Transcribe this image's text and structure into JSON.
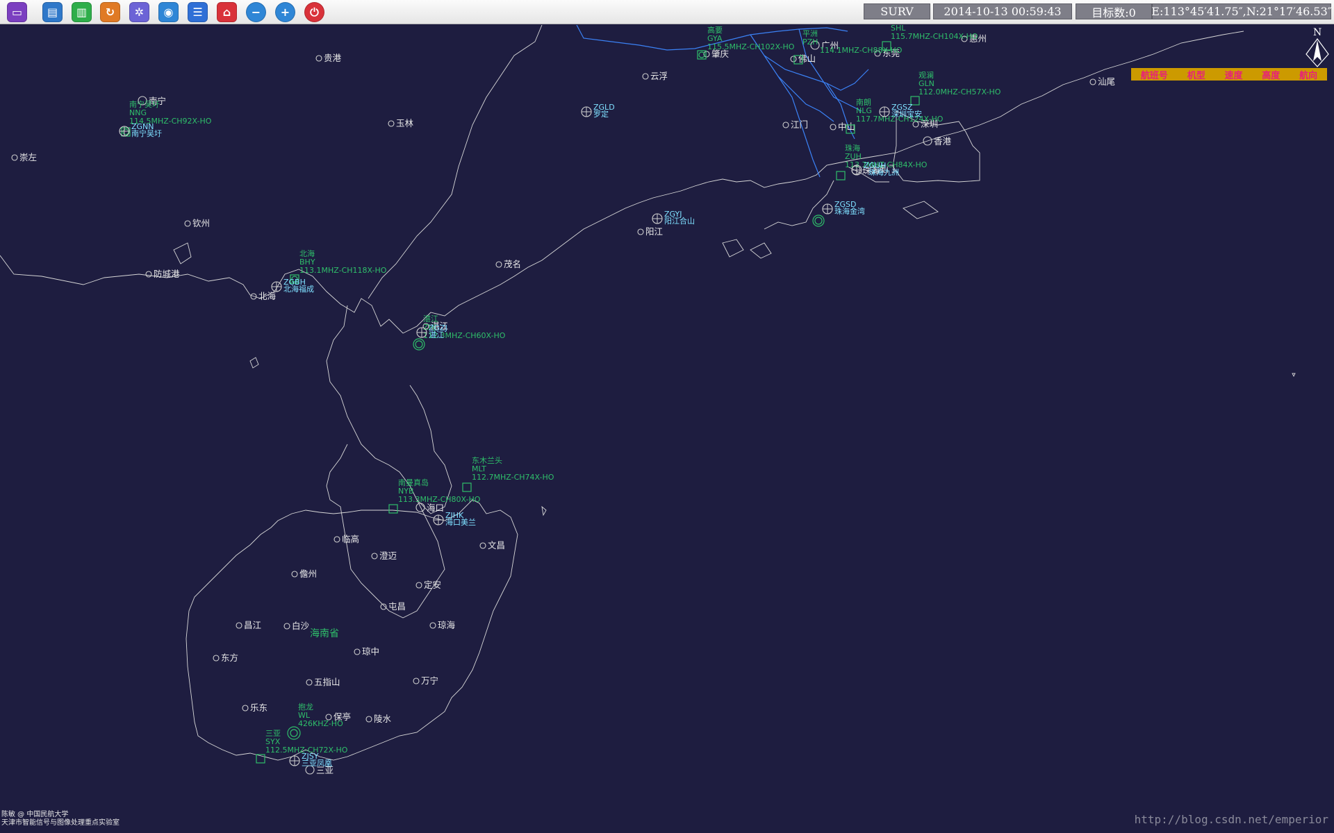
{
  "toolbar": {
    "buttons": [
      {
        "name": "monitor-icon",
        "color": "#7b3fc0"
      },
      {
        "name": "note-icon",
        "color": "#2f78c9"
      },
      {
        "name": "radar-icon",
        "color": "#2fae4a"
      },
      {
        "name": "refresh-icon",
        "color": "#e07a25"
      },
      {
        "name": "settings-icon",
        "color": "#6c63d6"
      },
      {
        "name": "globe-icon",
        "color": "#2f86d6"
      },
      {
        "name": "list-icon",
        "color": "#2f6fd6"
      },
      {
        "name": "home-icon",
        "color": "#d9323a"
      },
      {
        "name": "zoom-out-icon",
        "color": "#2f86d6"
      },
      {
        "name": "zoom-in-icon",
        "color": "#2f86d6"
      },
      {
        "name": "power-icon",
        "color": "#d9323a"
      }
    ],
    "mode": "SURV",
    "datetime": "2014-10-13 00:59:43",
    "target_count": "目标数:0",
    "coordinates": "E:113°45′41.75″,N:21°17′46.53″"
  },
  "legend": [
    "航班号",
    "机型",
    "速度",
    "高度",
    "航向"
  ],
  "north_label": "N",
  "province_label": "海南省",
  "cities": [
    "贵港",
    "南宁",
    "玉林",
    "崇左",
    "钦州",
    "防城港",
    "北海",
    "茂名",
    "云浮",
    "肇庆",
    "佛山",
    "广州",
    "东莞",
    "惠州",
    "江门",
    "中山",
    "深圳",
    "香港",
    "珠海",
    "澳门",
    "阳江",
    "湛江",
    "汕尾",
    "海口",
    "临高",
    "澄迈",
    "文昌",
    "儋州",
    "定安",
    "屯昌",
    "琼海",
    "昌江",
    "白沙",
    "琼中",
    "东方",
    "五指山",
    "万宁",
    "乐东",
    "保亭",
    "陵水",
    "三亚"
  ],
  "navaids": [
    {
      "name": "南宁吴圩",
      "code": "NNG",
      "freq": "114.5MHZ-CH92X-HO"
    },
    {
      "name": "北海",
      "code": "BHY",
      "freq": "113.1MHZ-CH118X-HO"
    },
    {
      "name": "高要",
      "code": "GYA",
      "freq": "115.5MHZ-CH102X-HO"
    },
    {
      "name": "平洲",
      "code": "PZH",
      "freq": "114.1MHZ-CH88X-HO"
    },
    {
      "name": "SHL",
      "code": "SHL",
      "freq": "115.7MHZ-CH104X-HO"
    },
    {
      "name": "观澜",
      "code": "GLN",
      "freq": "112.0MHZ-CH57X-HO"
    },
    {
      "name": "南朗",
      "code": "NLG",
      "freq": "117.7MHZ-CH124X-HO"
    },
    {
      "name": "珠海",
      "code": "ZUH",
      "freq": "113.7MHZ-CH84X-HO"
    },
    {
      "name": "湛江",
      "code": "ZHJ",
      "freq": "112.3MHZ-CH60X-HO"
    },
    {
      "name": "南曼真岛",
      "code": "NYB",
      "freq": "113.3MHZ-CH80X-HO"
    },
    {
      "name": "东木兰头",
      "code": "MLT",
      "freq": "112.7MHZ-CH74X-HO"
    },
    {
      "name": "抱龙",
      "code": "WL",
      "freq": "426KHZ-HO"
    },
    {
      "name": "三亚",
      "code": "SYX",
      "freq": "112.5MHZ-CH72X-HO"
    }
  ],
  "airports": [
    {
      "icao": "ZGNN",
      "name": "南宁吴圩"
    },
    {
      "icao": "ZGBH",
      "name": "北海福成"
    },
    {
      "icao": "ZGLD",
      "name": "罗定"
    },
    {
      "icao": "ZGYJ",
      "name": "阳江合山"
    },
    {
      "icao": "ZGSZ",
      "name": "深圳宝安"
    },
    {
      "icao": "ZGUH",
      "name": "珠海九洲"
    },
    {
      "icao": "ZGSD",
      "name": "珠海金湾"
    },
    {
      "icao": "ZGZJ",
      "name": "湛江"
    },
    {
      "icao": "ZJHK",
      "name": "海口美兰"
    },
    {
      "icao": "ZJSY",
      "name": "三亚凤凰"
    }
  ],
  "credit": [
    "陈敏 @ 中国民航大学",
    "天津市智能信号与图像处理重点实验室"
  ],
  "watermark": "http://blog.csdn.net/emperior"
}
